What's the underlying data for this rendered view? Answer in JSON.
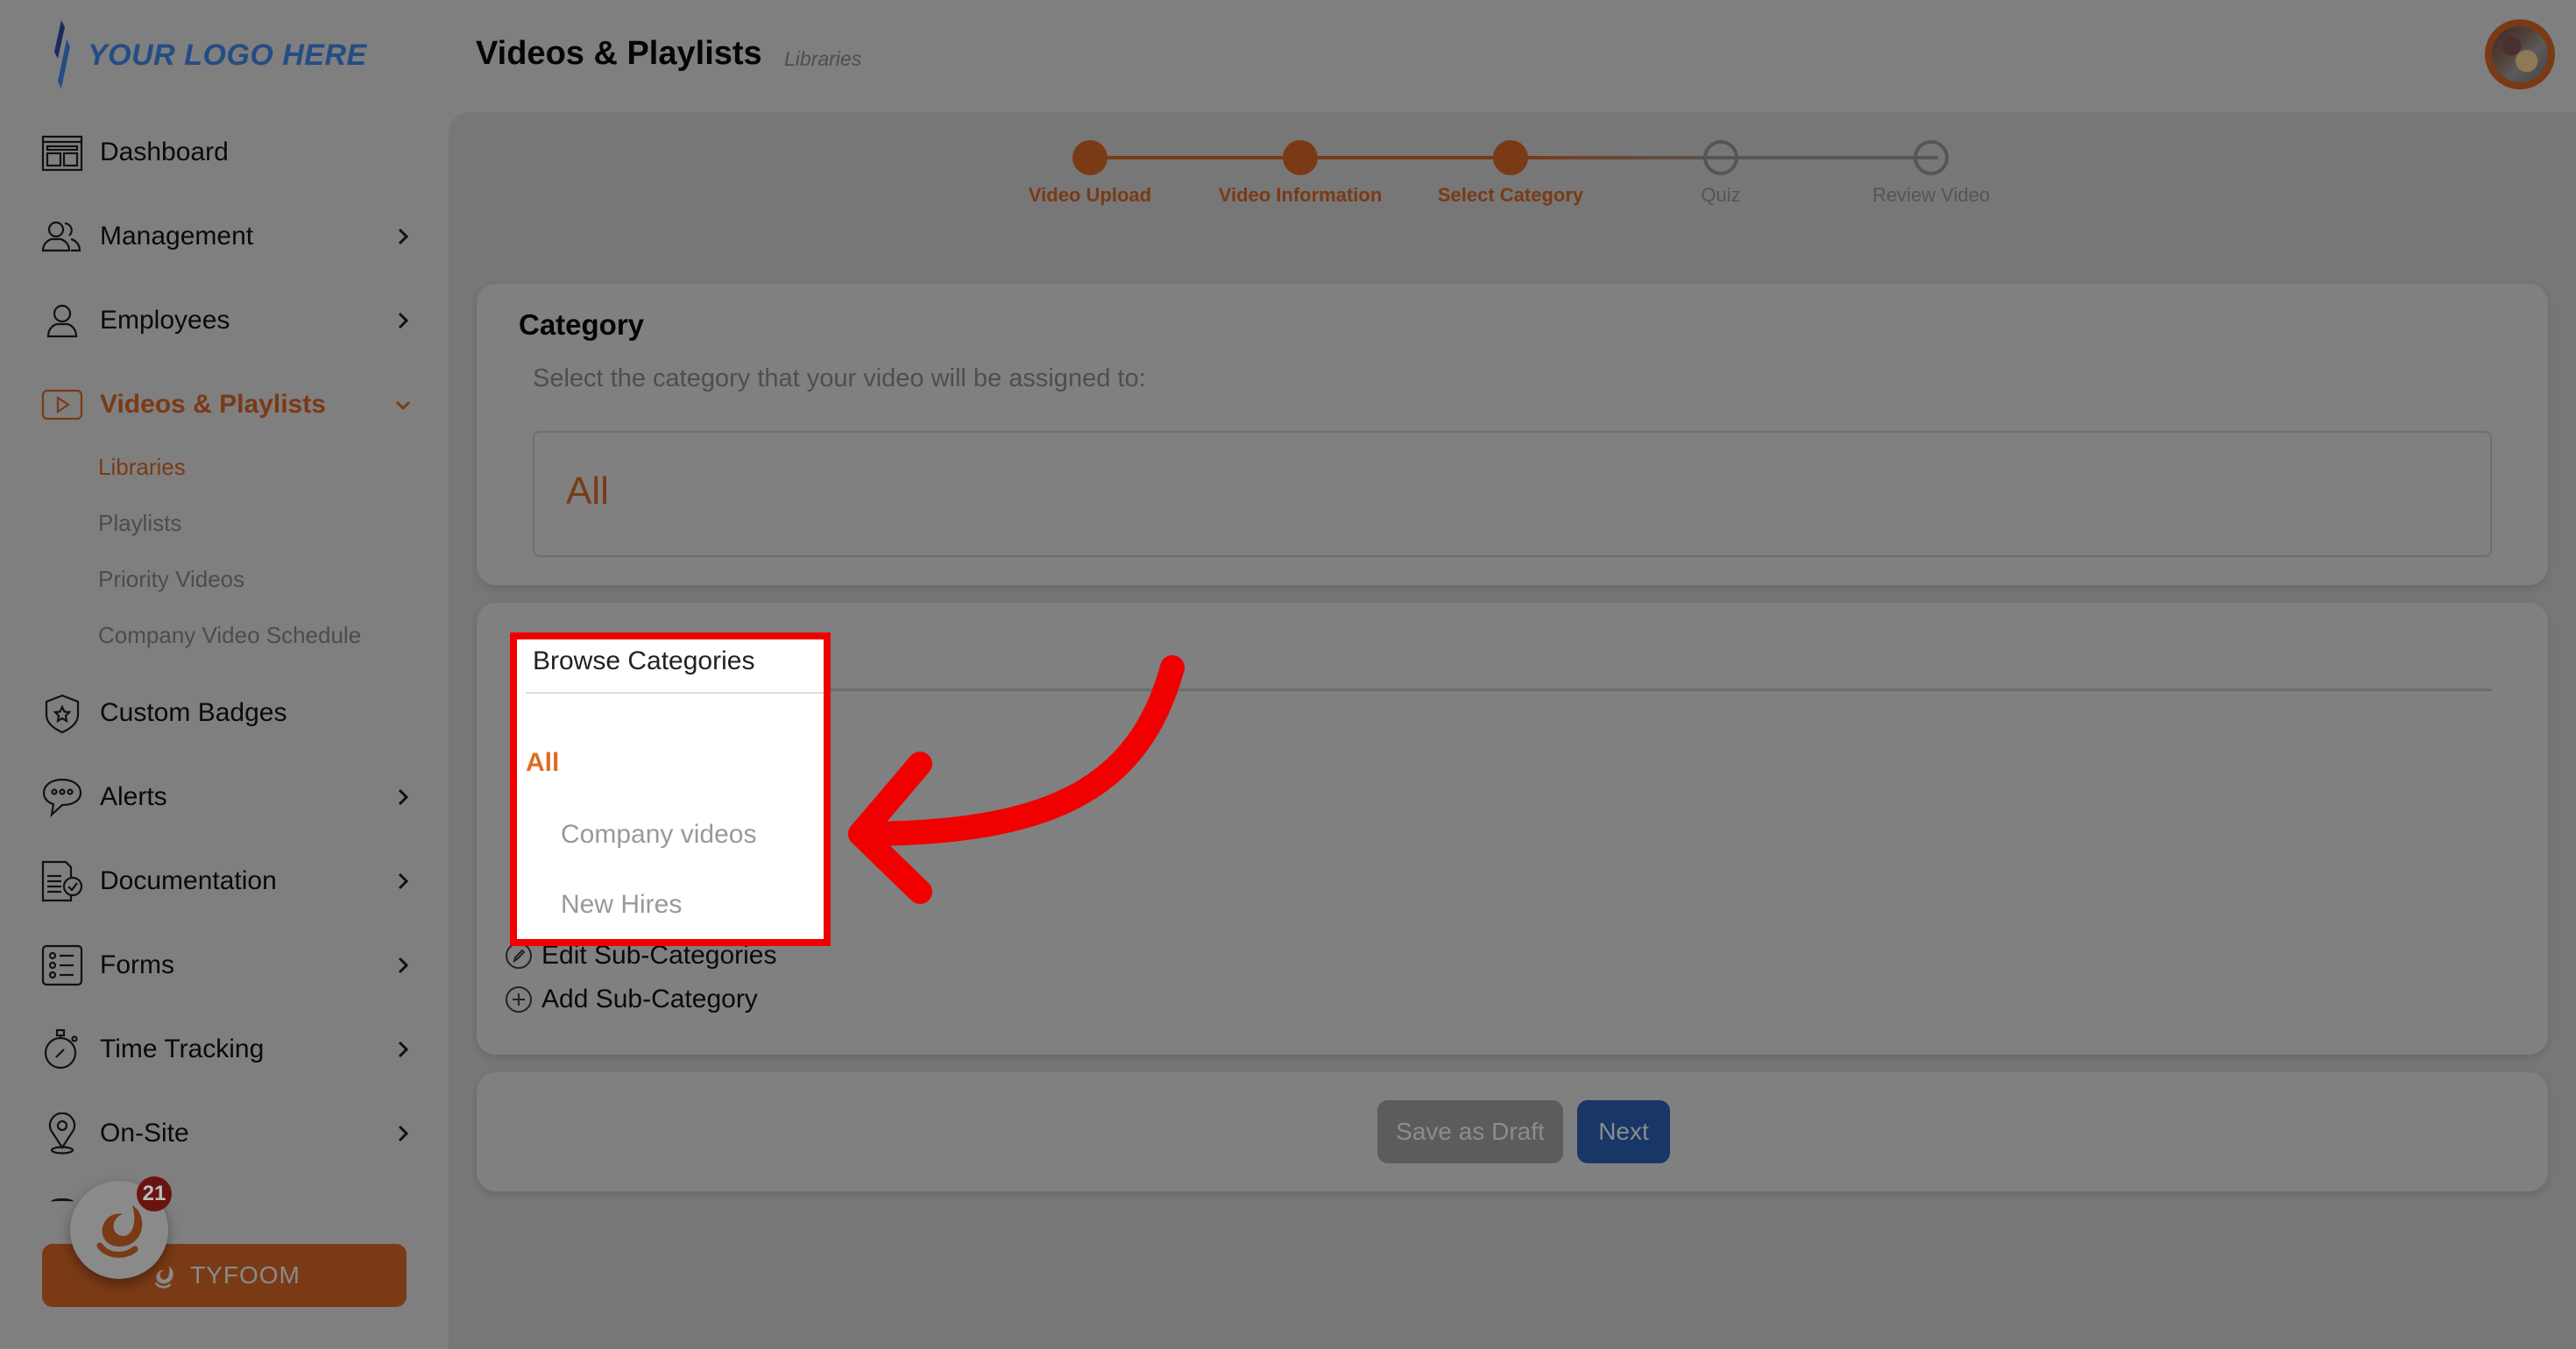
{
  "logo": {
    "text": "YOUR LOGO HERE",
    "color": "#244d84"
  },
  "header": {
    "title": "Videos & Playlists",
    "subtitle": "Libraries"
  },
  "sidebar": {
    "items": [
      {
        "label": "Dashboard",
        "icon": "dashboard-icon",
        "has_chevron": false
      },
      {
        "label": "Management",
        "icon": "users-group-icon",
        "has_chevron": true
      },
      {
        "label": "Employees",
        "icon": "user-icon",
        "has_chevron": true
      },
      {
        "label": "Videos & Playlists",
        "icon": "play-video-icon",
        "has_chevron": true,
        "expanded": true,
        "active": true
      },
      {
        "label": "Custom Badges",
        "icon": "shield-star-icon",
        "has_chevron": false
      },
      {
        "label": "Alerts",
        "icon": "chat-bubble-icon",
        "has_chevron": true
      },
      {
        "label": "Documentation",
        "icon": "document-check-icon",
        "has_chevron": true
      },
      {
        "label": "Forms",
        "icon": "list-form-icon",
        "has_chevron": true
      },
      {
        "label": "Time Tracking",
        "icon": "stopwatch-icon",
        "has_chevron": true
      },
      {
        "label": "On-Site",
        "icon": "map-pin-icon",
        "has_chevron": true
      }
    ],
    "sub_items": [
      {
        "label": "Libraries",
        "active": true
      },
      {
        "label": "Playlists",
        "active": false
      },
      {
        "label": "Priority Videos",
        "active": false
      },
      {
        "label": "Company Video Schedule",
        "active": false
      }
    ],
    "tyfoom_button": "TYFOOM",
    "notification_count": "21"
  },
  "stepper": {
    "steps": [
      {
        "label": "Video Upload",
        "status": "done"
      },
      {
        "label": "Video Information",
        "status": "done"
      },
      {
        "label": "Select Category",
        "status": "current"
      },
      {
        "label": "Quiz",
        "status": "todo"
      },
      {
        "label": "Review Video",
        "status": "todo"
      }
    ]
  },
  "category": {
    "title": "Category",
    "description": "Select the category that your video will be assigned to:",
    "selected_value": "All"
  },
  "browse": {
    "title": "Browse Categories",
    "items": [
      {
        "label": "All",
        "active": true
      },
      {
        "label": "Company videos",
        "active": false
      },
      {
        "label": "New Hires",
        "active": false
      }
    ],
    "edit_link": "Edit Sub-Categories",
    "add_link": "Add Sub-Category"
  },
  "actions": {
    "save_draft": "Save as Draft",
    "next": "Next"
  },
  "colors": {
    "accent": "#7a3a16",
    "highlight_annotation": "#f00000",
    "primary_button": "#183766",
    "active_category": "#e06b23"
  }
}
